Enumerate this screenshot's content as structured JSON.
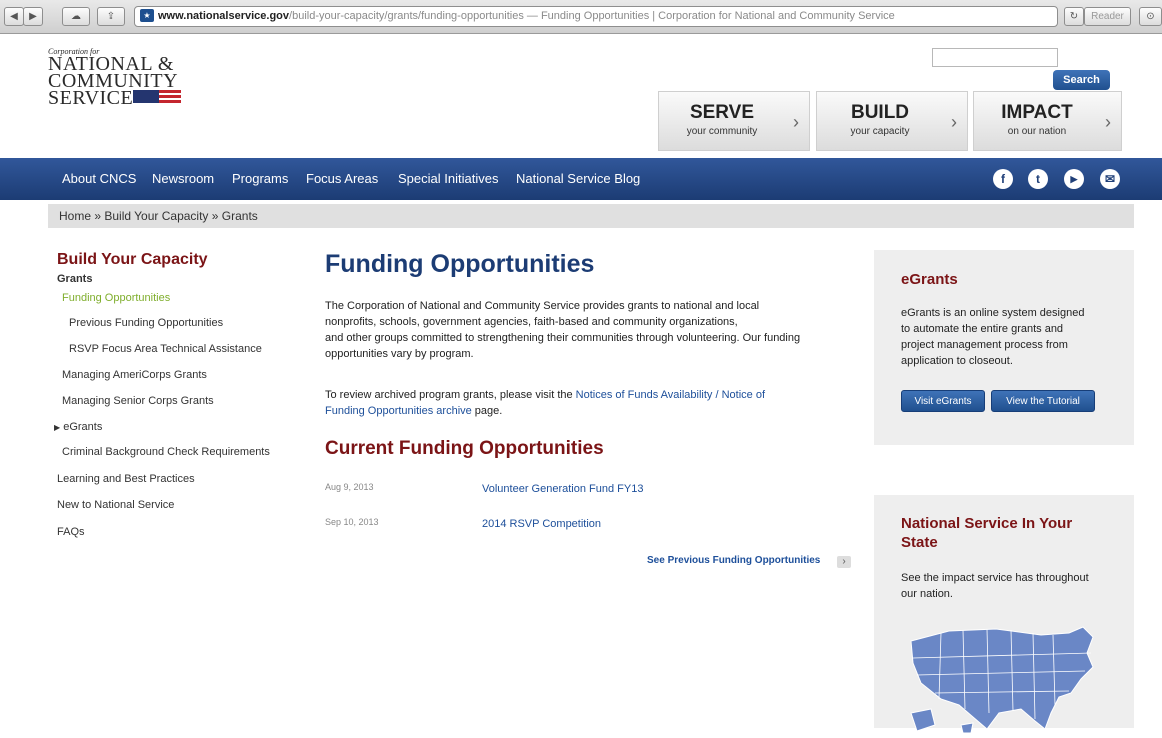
{
  "browser": {
    "url_host": "www.nationalservice.gov",
    "url_path": "/build-your-capacity/grants/funding-opportunities",
    "page_title": " — Funding Opportunities | Corporation for National and Community Service",
    "reader_label": "Reader"
  },
  "logo": {
    "small": "Corporation for",
    "line1": "NATIONAL &",
    "line2": "COMMUNITY",
    "line3": "SERVICE"
  },
  "header": {
    "search_button": "Search",
    "cta": [
      {
        "big": "SERVE",
        "small": "your community"
      },
      {
        "big": "BUILD",
        "small": "your capacity"
      },
      {
        "big": "IMPACT",
        "small": "on our nation"
      }
    ]
  },
  "nav": {
    "items": [
      "About CNCS",
      "Newsroom",
      "Programs",
      "Focus Areas",
      "Special Initiatives",
      "National Service Blog"
    ],
    "social": [
      "facebook-icon",
      "twitter-icon",
      "youtube-icon",
      "email-icon"
    ]
  },
  "breadcrumb": "Home » Build Your Capacity » Grants",
  "sidebar": {
    "title": "Build Your Capacity",
    "items": [
      {
        "label": "Grants"
      },
      {
        "label": "Funding Opportunities"
      },
      {
        "label": "Previous Funding Opportunities"
      },
      {
        "label": "RSVP Focus Area Technical Assistance"
      },
      {
        "label": "Managing AmeriCorps Grants"
      },
      {
        "label": "Managing Senior Corps Grants"
      },
      {
        "label": "eGrants"
      },
      {
        "label": "Criminal Background Check Requirements"
      },
      {
        "label": "Learning and Best Practices"
      },
      {
        "label": "New to National Service"
      },
      {
        "label": "FAQs"
      }
    ]
  },
  "main": {
    "title": "Funding Opportunities",
    "para1_lines": [
      "The Corporation of National and Community Service provides grants to national and local",
      "nonprofits, schools, government agencies, faith-based and community organizations,",
      "and other groups committed to strengthening their communities through volunteering. Our funding",
      "opportunities vary by program."
    ],
    "para2_prefix": "To review archived program grants, please visit the ",
    "para2_link1": "Notices of Funds Availability / Notice of",
    "para2_link2": "Funding Opportunities archive",
    "para2_suffix": " page.",
    "current_title": "Current Funding Opportunities",
    "opportunities": [
      {
        "date": "Aug 9, 2013",
        "title": "Volunteer Generation Fund FY13"
      },
      {
        "date": "Sep 10, 2013",
        "title": "2014 RSVP Competition"
      }
    ],
    "see_previous": "See Previous Funding Opportunities"
  },
  "egrants": {
    "title": "eGrants",
    "text_lines": [
      "eGrants is an online system designed",
      "to automate the entire grants and",
      "project management process from",
      "application to closeout."
    ],
    "visit_button": "Visit eGrants",
    "tutorial_button": "View the Tutorial"
  },
  "state": {
    "title_lines": [
      "National Service In Your",
      "State"
    ],
    "text_lines": [
      "See the impact service has throughout",
      "our nation."
    ]
  },
  "colors": {
    "nav": "#1f3f78",
    "accent_red": "#7b1416",
    "active_green": "#7fae2c",
    "link_blue": "#1d4f9a"
  }
}
